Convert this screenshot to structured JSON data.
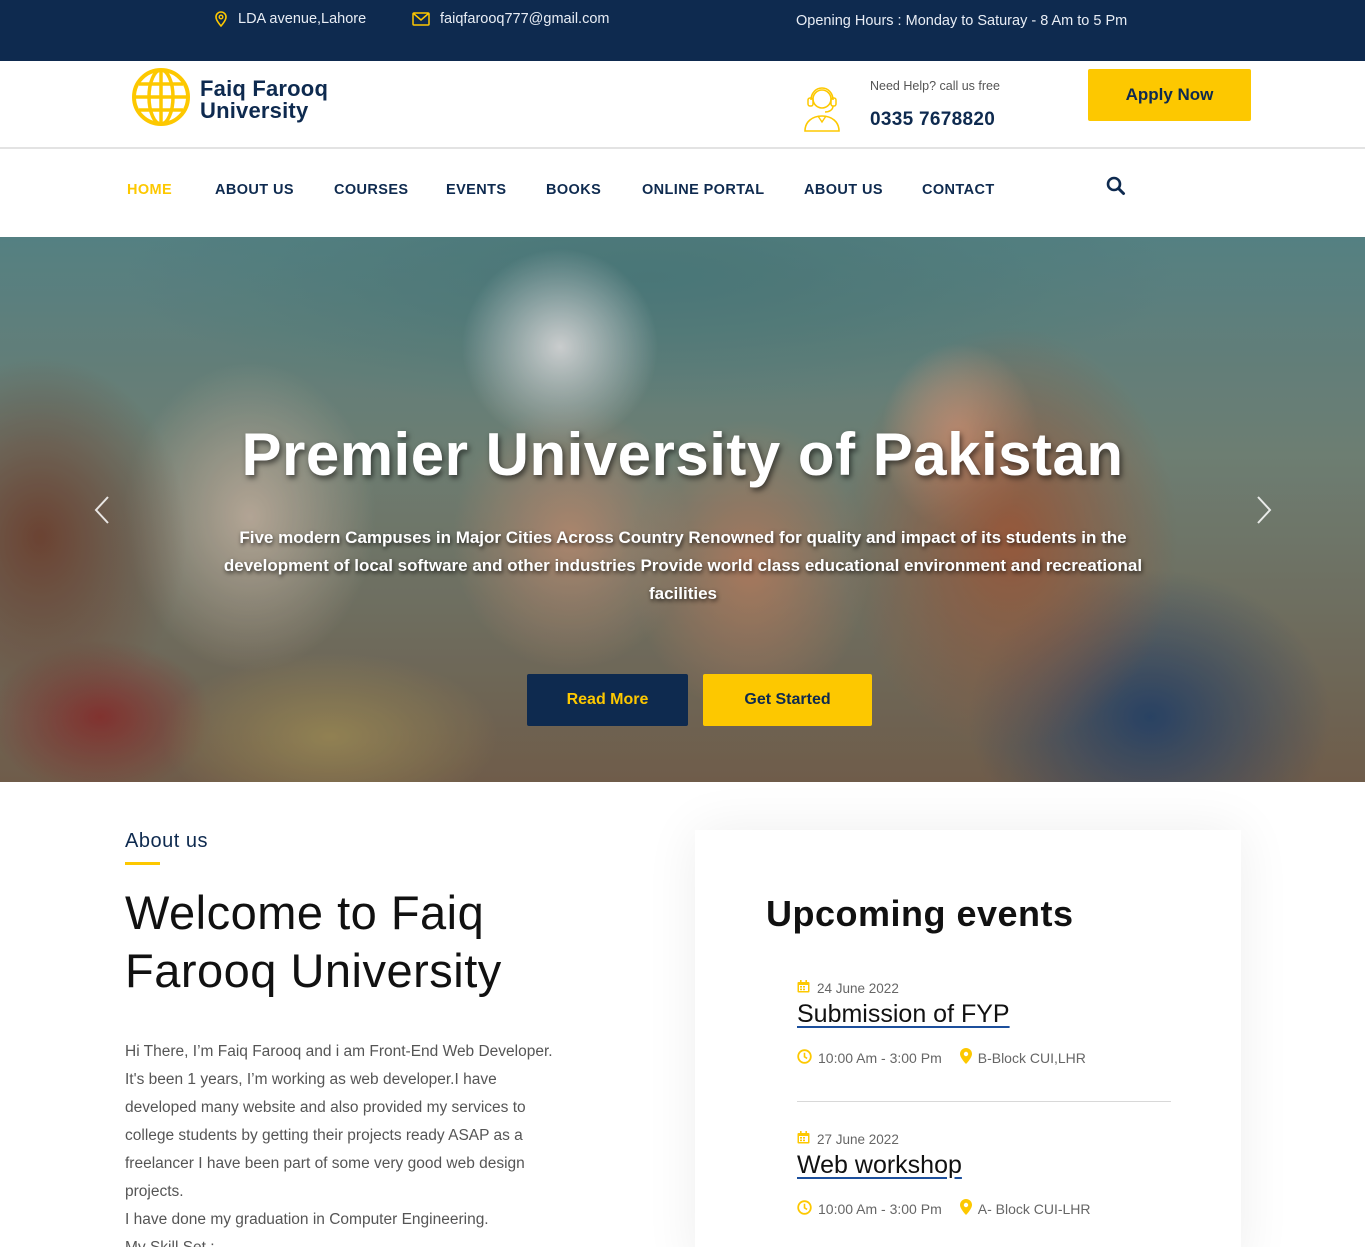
{
  "topbar": {
    "address": "LDA avenue,Lahore",
    "email": "faiqfarooq777@gmail.com",
    "hours": "Opening Hours : Monday to Saturay - 8 Am to 5 Pm"
  },
  "header": {
    "logo_line1": "Faiq Farooq",
    "logo_line2": "University",
    "help_label": "Need Help? call us free",
    "phone": "0335 7678820",
    "apply_label": "Apply Now"
  },
  "nav": {
    "items": [
      "HOME",
      "ABOUT US",
      "COURSES",
      "EVENTS",
      "BOOKS",
      "ONLINE PORTAL",
      "ABOUT US",
      "CONTACT"
    ],
    "active_index": 0
  },
  "hero": {
    "title": "Premier University of Pakistan",
    "subtitle": "Five modern Campuses in Major Cities Across Country Renowned for quality and impact of its students in the development of local software and other industries Provide world class educational environment and recreational facilities",
    "read_more": "Read More",
    "get_started": "Get Started"
  },
  "about": {
    "kicker": "About us",
    "title": "Welcome to Faiq Farooq University",
    "paragraphs": [
      "Hi There, I’m Faiq Farooq and i am Front-End Web Developer. It's been 1 years, I’m working as web developer.I have developed many website and also provided my services to college students by getting their projects ready ASAP as a freelancer I have been part of some very good web design projects.",
      "I have done my graduation in Computer Engineering.",
      "My Skill Set :"
    ]
  },
  "events": {
    "title": "Upcoming events",
    "items": [
      {
        "date": "24 June 2022",
        "title": "Submission of FYP",
        "time": "10:00 Am - 3:00 Pm",
        "location": "B-Block CUI,LHR"
      },
      {
        "date": "27 June 2022",
        "title": "Web workshop",
        "time": "10:00 Am - 3:00 Pm",
        "location": "A- Block CUI-LHR"
      }
    ]
  },
  "colors": {
    "navy": "#0e2a4f",
    "accent": "#fdc800"
  },
  "icons": [
    "location-pin-icon",
    "envelope-icon",
    "globe-icon",
    "support-agent-icon",
    "search-icon",
    "chevron-left-icon",
    "chevron-right-icon",
    "calendar-icon",
    "clock-icon",
    "map-pin-icon"
  ]
}
